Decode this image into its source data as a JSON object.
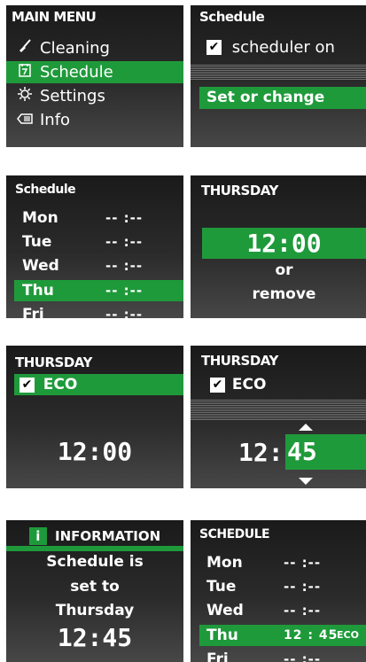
{
  "main_menu": {
    "title": "MAIN MENU",
    "items": [
      {
        "label": "Cleaning",
        "icon": "broom-icon"
      },
      {
        "label": "Schedule",
        "icon": "calendar-icon"
      },
      {
        "label": "Settings",
        "icon": "gear-icon"
      },
      {
        "label": "Info",
        "icon": "info-icon"
      }
    ],
    "selected": "Schedule"
  },
  "schedule_toggle": {
    "title": "Schedule",
    "checkbox_label": "scheduler on",
    "checked": true,
    "action_label": "Set or change"
  },
  "schedule_list": {
    "title": "Schedule",
    "days": [
      {
        "day": "Mon",
        "time": "-- :--"
      },
      {
        "day": "Tue",
        "time": "-- :--"
      },
      {
        "day": "Wed",
        "time": "-- :--"
      },
      {
        "day": "Thu",
        "time": "-- :--"
      },
      {
        "day": "Fri",
        "time": "-- :--"
      }
    ],
    "selected": "Thu"
  },
  "thursday_set": {
    "title": "THURSDAY",
    "time": "12:00",
    "or_label": "or",
    "remove_label": "remove"
  },
  "thursday_eco": {
    "title": "THURSDAY",
    "eco_label": "ECO",
    "time": "12:00"
  },
  "thursday_edit": {
    "title": "THURSDAY",
    "eco_label": "ECO",
    "hours": "12:",
    "minutes": "45"
  },
  "information": {
    "title": "INFORMATION",
    "line1": "Schedule is",
    "line2": "set to",
    "line3": "Thursday",
    "time": "12:45"
  },
  "schedule_final": {
    "title": "SCHEDULE",
    "days": [
      {
        "day": "Mon",
        "time": "-- :--"
      },
      {
        "day": "Tue",
        "time": "-- :--"
      },
      {
        "day": "Wed",
        "time": "-- :--"
      },
      {
        "day": "Thu",
        "time": "12 : 45",
        "eco": "ECO"
      },
      {
        "day": "Fri",
        "time": "-- :--"
      }
    ],
    "selected": "Thu"
  },
  "colors": {
    "accent": "#1f9a3b",
    "panel_dark": "#1a1a1a",
    "text": "#ffffff"
  }
}
